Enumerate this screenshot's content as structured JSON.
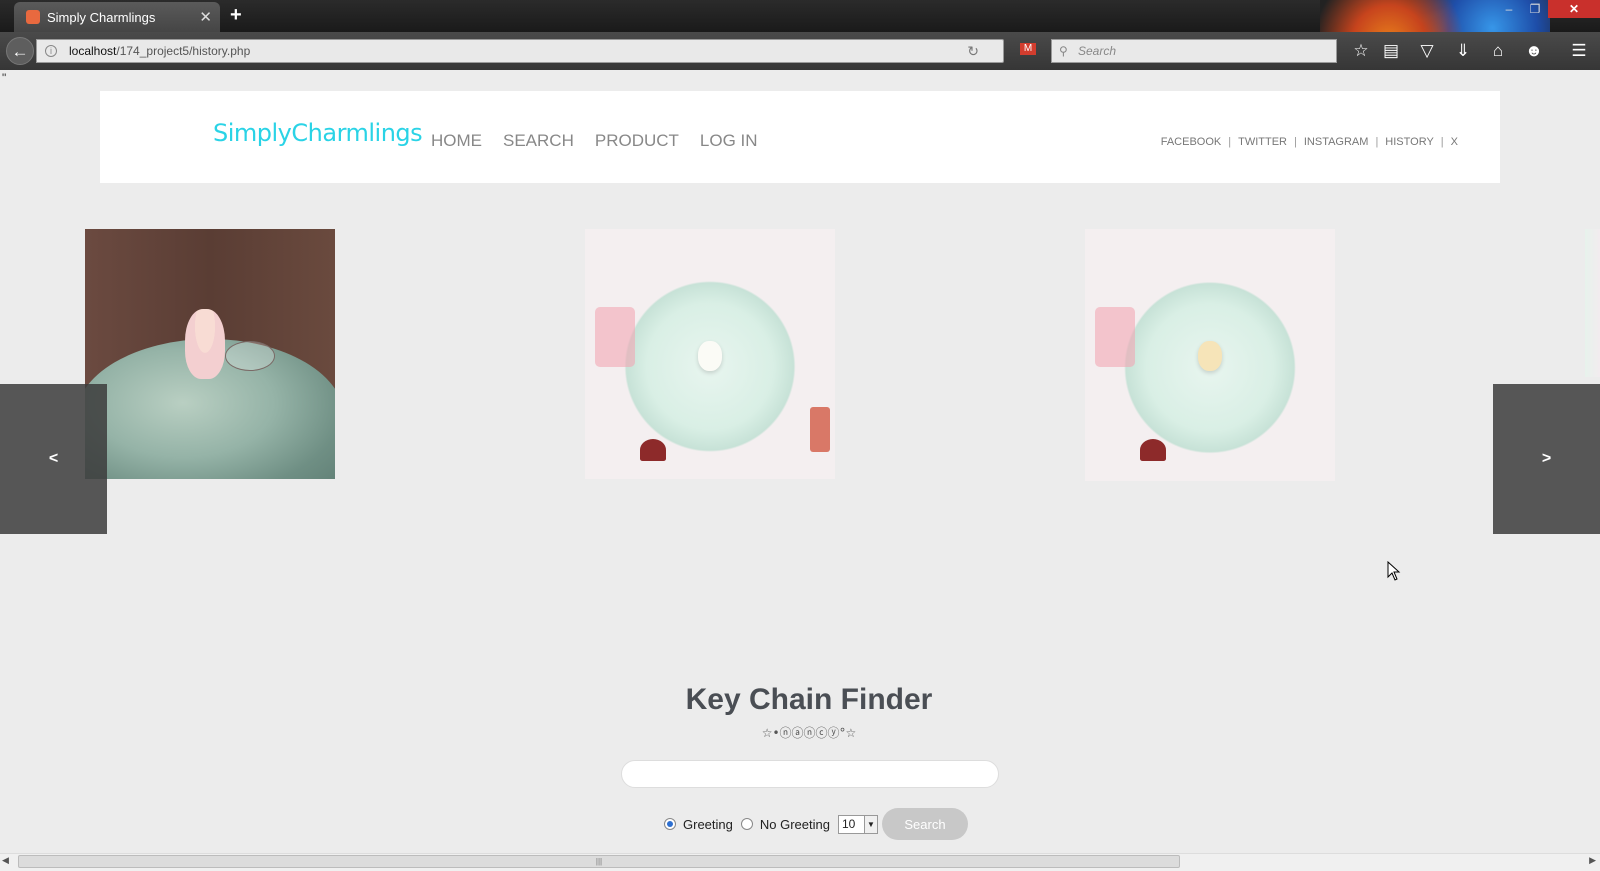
{
  "browser": {
    "tab_title": "Simply Charmlings",
    "tab_close": "✕",
    "new_tab": "+",
    "url_host": "localhost",
    "url_path": "/174_project5/history.php",
    "search_placeholder": "Search",
    "window_min": "‒",
    "window_max": "❐",
    "window_close": "✕"
  },
  "page": {
    "stray_text": "\"",
    "logo": "SimplyCharmlings",
    "nav": [
      "HOME",
      "SEARCH",
      "PRODUCT",
      "LOG IN"
    ],
    "social": [
      "FACEBOOK",
      "TWITTER",
      "INSTAGRAM",
      "HISTORY",
      "X"
    ],
    "carousel": {
      "prev_label": "<",
      "next_label": ">"
    },
    "finder": {
      "title": "Key Chain Finder",
      "subtitle": "☆•ⓝⓐⓝⓒⓨ°☆",
      "radio_greeting": "Greeting",
      "radio_no_greeting": "No Greeting",
      "count_value": "10",
      "search_button": "Search"
    }
  }
}
